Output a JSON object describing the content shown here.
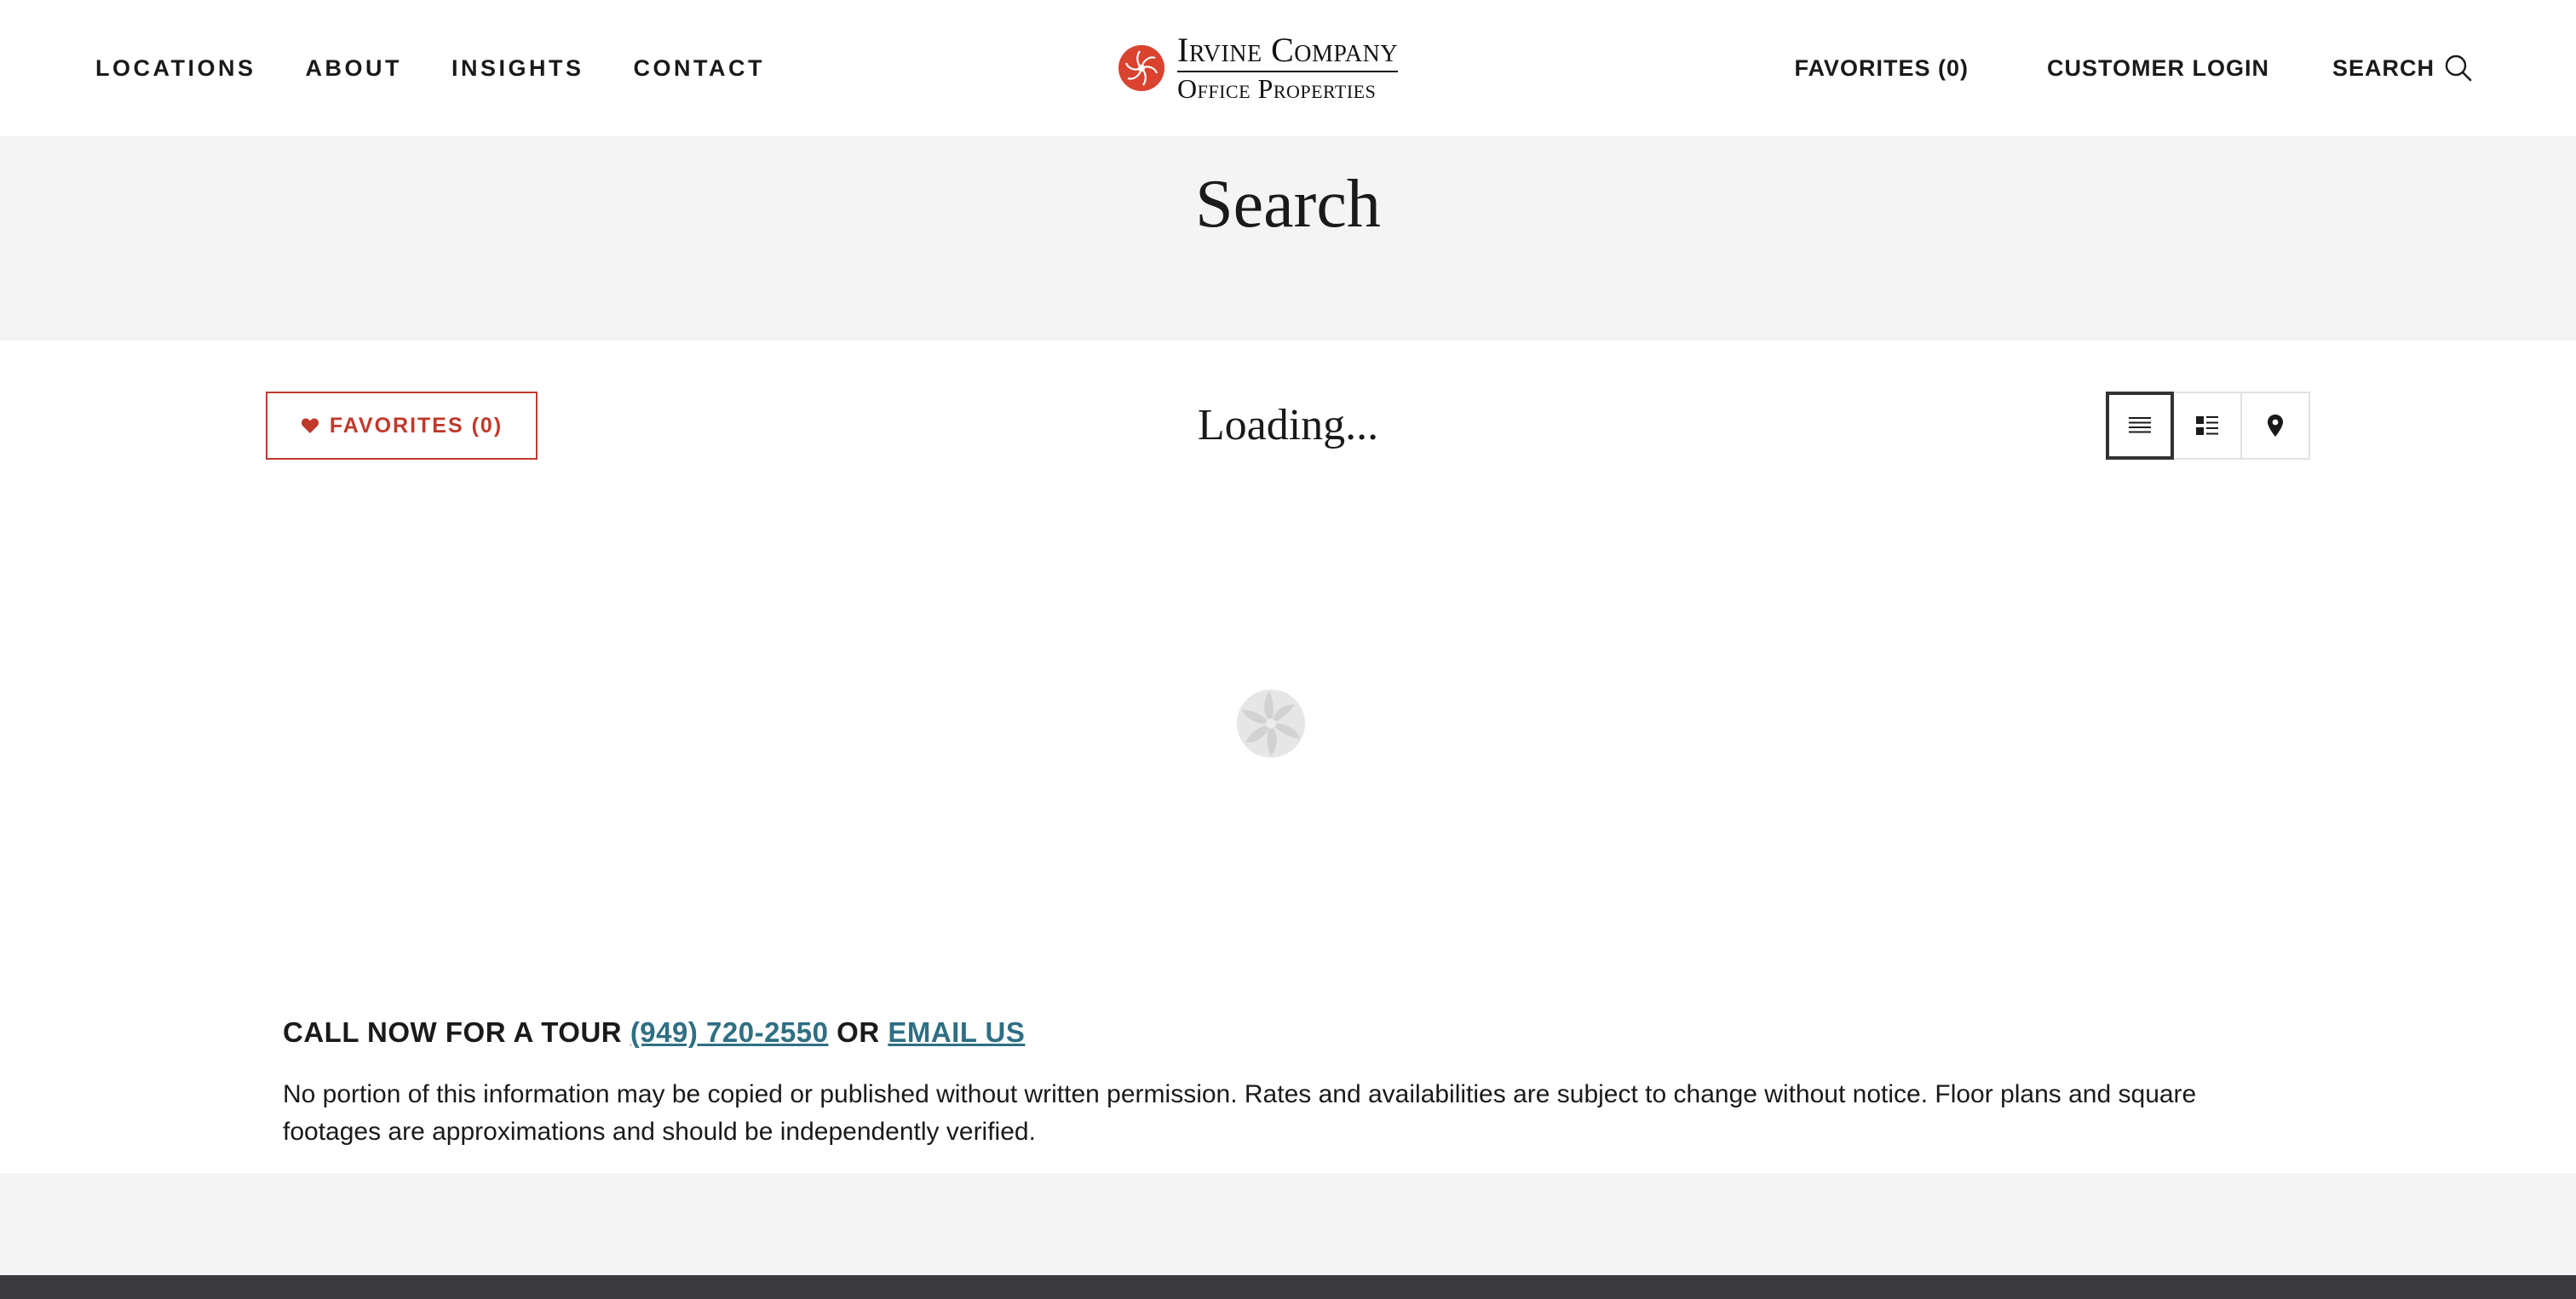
{
  "header": {
    "nav_left": [
      "LOCATIONS",
      "ABOUT",
      "INSIGHTS",
      "CONTACT"
    ],
    "logo": {
      "line1": "Irvine Company",
      "line2": "Office Properties",
      "mark_icon": "sunburst-logo-icon",
      "mark_color": "#d9432f"
    },
    "nav_right": {
      "favorites": "FAVORITES (0)",
      "customer_login": "CUSTOMER LOGIN",
      "search": "SEARCH",
      "search_icon": "search-icon"
    }
  },
  "page_title": "Search",
  "toolbar": {
    "favorites_button": "FAVORITES (0)",
    "favorites_icon": "heart-icon",
    "status": "Loading...",
    "views": [
      {
        "name": "list-view",
        "icon": "list-icon",
        "active": true
      },
      {
        "name": "detail-list-view",
        "icon": "detail-list-icon",
        "active": false
      },
      {
        "name": "map-view",
        "icon": "map-pin-icon",
        "active": false
      }
    ]
  },
  "spinner_icon": "loading-spinner-icon",
  "cta": {
    "prefix": "CALL NOW FOR A TOUR",
    "phone": "(949) 720-2550",
    "or": "OR",
    "email": "EMAIL US"
  },
  "disclaimer": "No portion of this information may be copied or published without written permission. Rates and availabilities are subject to change without notice. Floor plans and square footages are approximations and should be independently verified.",
  "colors": {
    "accent": "#c0392b",
    "link": "#2f6f84",
    "band": "#f4f4f4",
    "footer": "#3a3a3e"
  }
}
